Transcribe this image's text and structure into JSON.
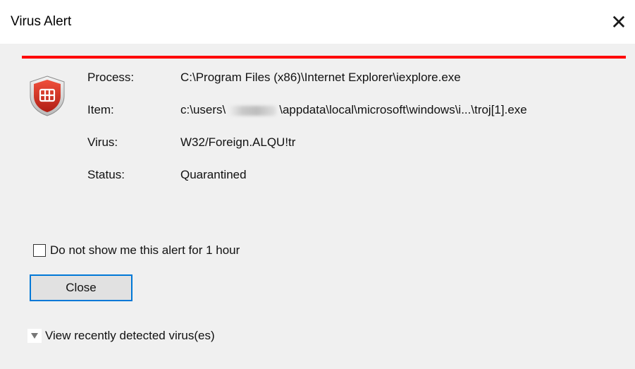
{
  "window": {
    "title": "Virus Alert",
    "close_glyph": "✕"
  },
  "alert": {
    "accent_color": "#ff0000",
    "icon": "fortinet-shield-icon",
    "fields": [
      {
        "label": "Process:",
        "value": "C:\\Program Files (x86)\\Internet Explorer\\iexplore.exe"
      },
      {
        "label": "Item:",
        "value_prefix": "c:\\users\\",
        "value_suffix": "\\appdata\\local\\microsoft\\windows\\i...\\troj[1].exe"
      },
      {
        "label": "Virus:",
        "value": "W32/Foreign.ALQU!tr"
      },
      {
        "label": "Status:",
        "value": "Quarantined"
      }
    ]
  },
  "options": {
    "mute_checkbox_label": "Do not show me this alert for 1 hour",
    "mute_checked": false,
    "close_button_label": "Close",
    "view_recent_label": "View recently detected virus(es)"
  }
}
